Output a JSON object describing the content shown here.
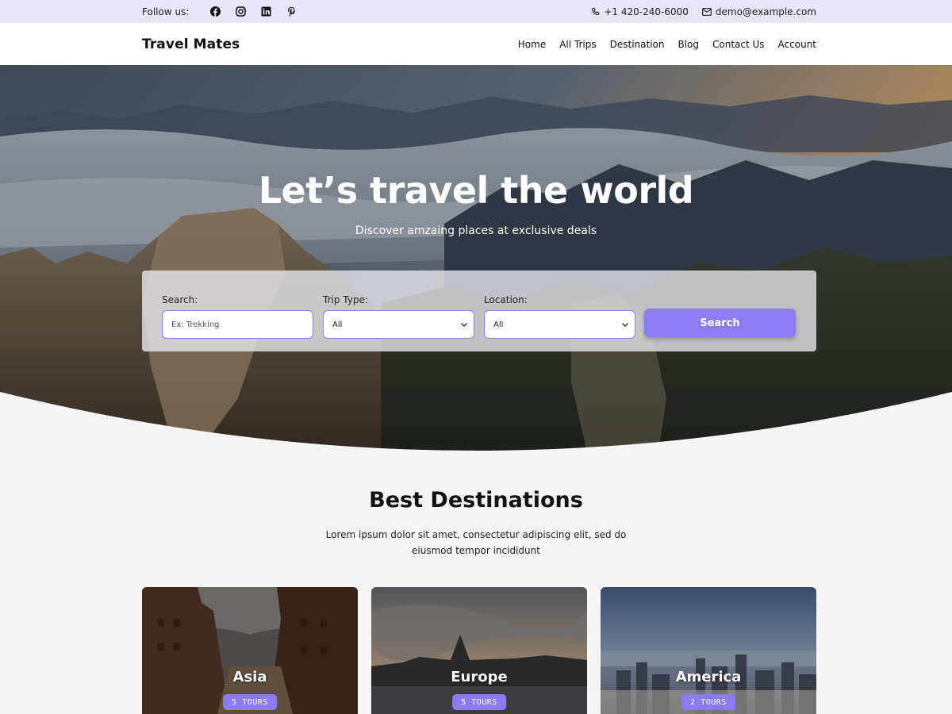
{
  "topbar": {
    "follow_label": "Follow us:",
    "socials": [
      "facebook-icon",
      "instagram-icon",
      "linkedin-icon",
      "pinterest-icon"
    ],
    "phone": "+1 420-240-6000",
    "email": "demo@example.com"
  },
  "header": {
    "logo": "Travel Mates",
    "nav": [
      "Home",
      "All Trips",
      "Destination",
      "Blog",
      "Contact Us",
      "Account"
    ]
  },
  "hero": {
    "title": "Let’s travel the world",
    "subtitle": "Discover amzaing places at exclusive deals"
  },
  "search": {
    "search_label": "Search:",
    "search_placeholder": "Ex: Trekking",
    "trip_type_label": "Trip Type:",
    "trip_type_value": "All",
    "location_label": "Location:",
    "location_value": "All",
    "button_label": "Search"
  },
  "destinations": {
    "title": "Best Destinations",
    "description": "Lorem ipsum dolor sit amet, consectetur adipiscing elit, sed do eiusmod tempor incididunt",
    "cards": [
      {
        "name": "Asia",
        "tours": "5 TOURS"
      },
      {
        "name": "Europe",
        "tours": "5 TOURS"
      },
      {
        "name": "America",
        "tours": "2 TOURS"
      }
    ]
  },
  "colors": {
    "accent": "#8a7cf7",
    "topbar_bg": "#e9e5f6",
    "page_bg": "#f5f5f6"
  }
}
